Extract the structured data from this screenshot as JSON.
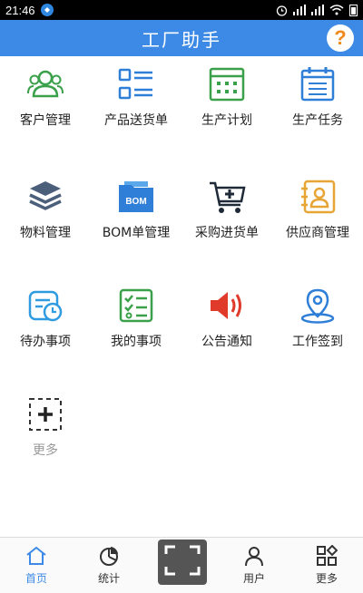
{
  "status_bar": {
    "time": "21:46"
  },
  "header": {
    "title": "工厂助手",
    "help_label": "?"
  },
  "grid": [
    {
      "label": "客户管理",
      "icon": "customers-icon"
    },
    {
      "label": "产品送货单",
      "icon": "list-icon"
    },
    {
      "label": "生产计划",
      "icon": "calendar-icon"
    },
    {
      "label": "生产任务",
      "icon": "task-calendar-icon"
    },
    {
      "label": "物料管理",
      "icon": "layers-icon"
    },
    {
      "label": "BOM单管理",
      "icon": "bom-folder-icon",
      "badge": "BOM"
    },
    {
      "label": "采购进货单",
      "icon": "cart-icon"
    },
    {
      "label": "供应商管理",
      "icon": "contact-card-icon"
    },
    {
      "label": "待办事项",
      "icon": "todo-clock-icon"
    },
    {
      "label": "我的事项",
      "icon": "checklist-icon"
    },
    {
      "label": "公告通知",
      "icon": "speaker-icon"
    },
    {
      "label": "工作签到",
      "icon": "location-pin-icon"
    },
    {
      "label": "更多",
      "icon": "add-dashed-icon"
    }
  ],
  "tabbar": {
    "tabs": [
      {
        "label": "首页",
        "icon": "home-icon"
      },
      {
        "label": "统计",
        "icon": "pie-chart-icon"
      },
      {
        "label": "用户",
        "icon": "user-icon"
      },
      {
        "label": "更多",
        "icon": "grid-icon"
      }
    ],
    "scan_icon": "scan-icon"
  },
  "colors": {
    "primary": "#3c8ae5",
    "green": "#3aa04a",
    "orange": "#f08a1c",
    "red": "#e03a2a"
  }
}
